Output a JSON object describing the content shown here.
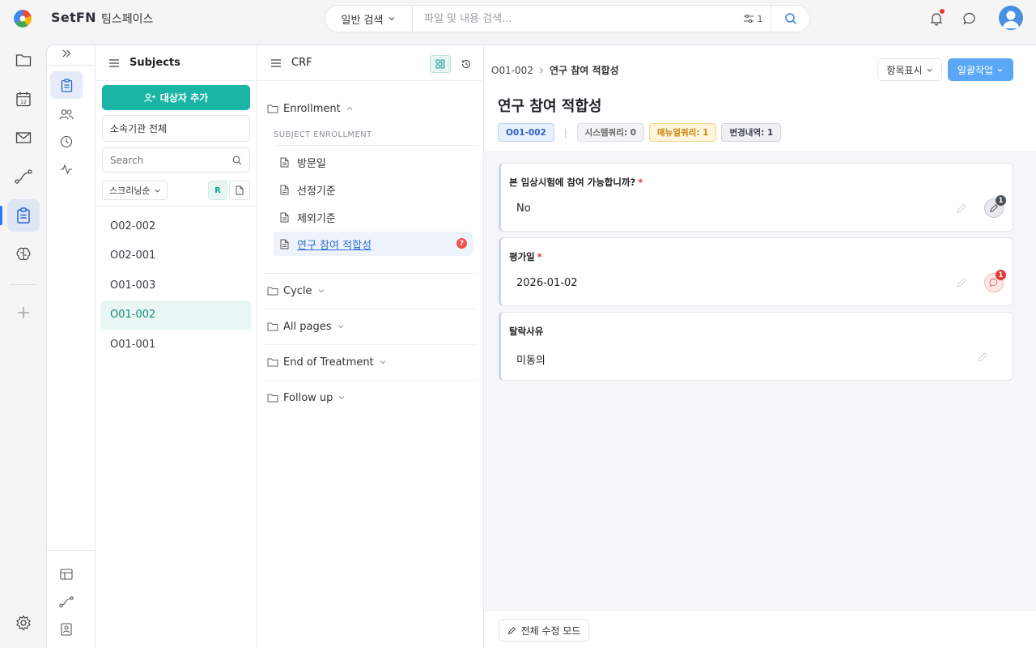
{
  "app": {
    "brand": "SetFN",
    "workspace": "팀스페이스"
  },
  "search": {
    "mode": "일반 검색",
    "placeholder": "파일 및 내용 검색...",
    "filter_count": "1"
  },
  "subjects_panel": {
    "title": "Subjects",
    "add_button": "대상자 추가",
    "org_select": "소속기관 전체",
    "search_placeholder": "Search",
    "sort_label": "스크리닝순",
    "r_label": "R",
    "items": [
      "O02-002",
      "O02-001",
      "O01-003",
      "O01-002",
      "O01-001"
    ],
    "selected": "O01-002"
  },
  "crf_panel": {
    "title": "CRF",
    "folders": [
      {
        "label": "Enrollment",
        "expanded": true
      },
      {
        "label": "Cycle",
        "expanded": false
      },
      {
        "label": "All pages",
        "expanded": false
      },
      {
        "label": "End of Treatment",
        "expanded": false
      },
      {
        "label": "Follow up",
        "expanded": false
      }
    ],
    "section_label": "SUBJECT ENROLLMENT",
    "pages": [
      "방문일",
      "선정기준",
      "제외기준",
      "연구 참여 적합성"
    ],
    "active_page": "연구 참여 적합성"
  },
  "content": {
    "breadcrumb": {
      "subject": "O01-002",
      "page": "연구 참여 적합성"
    },
    "display_button": "항목표시",
    "bulk_button": "일괄작업",
    "title": "연구 참여 적합성",
    "tags": {
      "subject": "O01-002",
      "system_query": "시스템쿼리: 0",
      "manual_query": "매뉴얼쿼리: 1",
      "change_history": "변경내역: 1"
    },
    "questions": [
      {
        "label": "본 임상시험에 참여 가능합니까?",
        "required": "*",
        "value": "No",
        "badge": "1"
      },
      {
        "label": "평가일",
        "required": "*",
        "value": "2026-01-02",
        "badge": "1"
      },
      {
        "label": "탈락사유",
        "value": "미동의"
      }
    ],
    "edit_all_button": "전체 수정 모드"
  },
  "colors": {
    "accent_teal": "#19b5a5",
    "primary_blue": "#5aa7f5",
    "error_red": "#e53935"
  }
}
